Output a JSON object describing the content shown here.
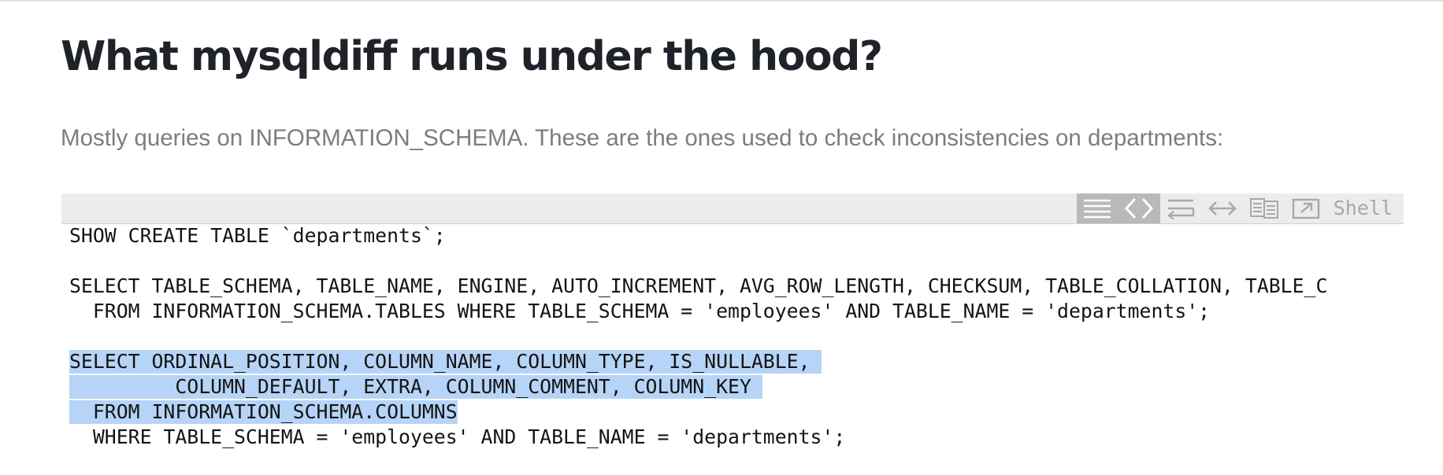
{
  "article": {
    "title": "What mysqldiff runs under the hood?",
    "intro": "Mostly queries on INFORMATION_SCHEMA. These are the ones used to check inconsistencies on departments:"
  },
  "code": {
    "language_label": "Shell",
    "toolbar_icons": [
      "view-plain-icon",
      "view-source-icon",
      "wrap-lines-icon",
      "expand-icon",
      "copy-icon",
      "open-new-window-icon"
    ],
    "selection_color": "#b6d4f7",
    "lines": [
      "SHOW CREATE TABLE `departments`;",
      "",
      "SELECT TABLE_SCHEMA, TABLE_NAME, ENGINE, AUTO_INCREMENT, AVG_ROW_LENGTH, CHECKSUM, TABLE_COLLATION, TABLE_C",
      "  FROM INFORMATION_SCHEMA.TABLES WHERE TABLE_SCHEMA = 'employees' AND TABLE_NAME = 'departments';",
      "",
      "SELECT ORDINAL_POSITION, COLUMN_NAME, COLUMN_TYPE, IS_NULLABLE,",
      "         COLUMN_DEFAULT, EXTRA, COLUMN_COMMENT, COLUMN_KEY",
      "  FROM INFORMATION_SCHEMA.COLUMNS",
      "  WHERE TABLE_SCHEMA = 'employees' AND TABLE_NAME = 'departments';"
    ]
  }
}
